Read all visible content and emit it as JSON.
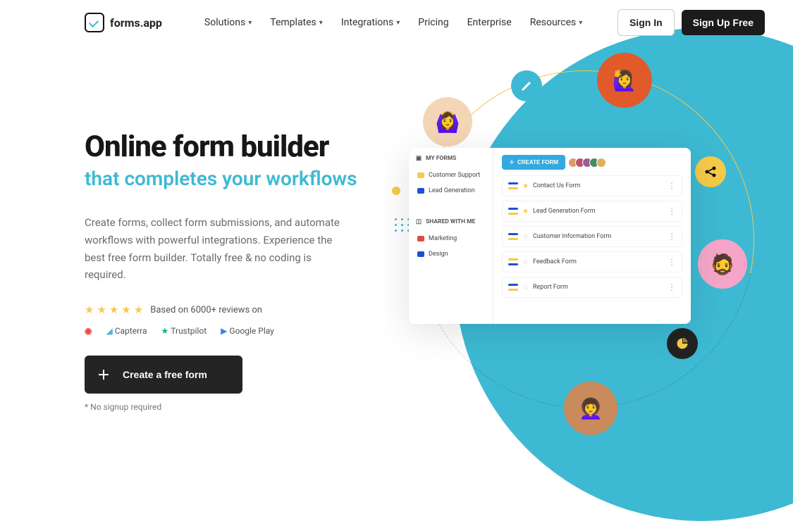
{
  "brand": "forms.app",
  "nav": {
    "solutions": "Solutions",
    "templates": "Templates",
    "integrations": "Integrations",
    "pricing": "Pricing",
    "enterprise": "Enterprise",
    "resources": "Resources"
  },
  "auth": {
    "signin": "Sign In",
    "signup": "Sign Up Free"
  },
  "hero": {
    "title": "Online form builder",
    "subtitle": "that completes your workflows",
    "desc": "Create forms, collect form submissions, and automate workflows with powerful integrations. Experience the best free form builder. Totally free & no coding is required.",
    "reviews": "Based on 6000+ reviews on",
    "rl": {
      "g2": "G2",
      "capterra": "Capterra",
      "trustpilot": "Trustpilot",
      "googleplay": "Google Play"
    },
    "cta": "Create a free form",
    "footnote": "* No signup required"
  },
  "app": {
    "myforms": "MY FORMS",
    "shared": "SHARED WITH ME",
    "folders": {
      "customer_support": "Customer Support",
      "lead_generation": "Lead Generation",
      "marketing": "Marketing",
      "design": "Design"
    },
    "create": "CREATE FORM",
    "forms": {
      "f1": "Contact Us Form",
      "f2": "Lead Generation Form",
      "f3": "Customer Information Form",
      "f4": "Feedback Form",
      "f5": "Report Form"
    }
  }
}
